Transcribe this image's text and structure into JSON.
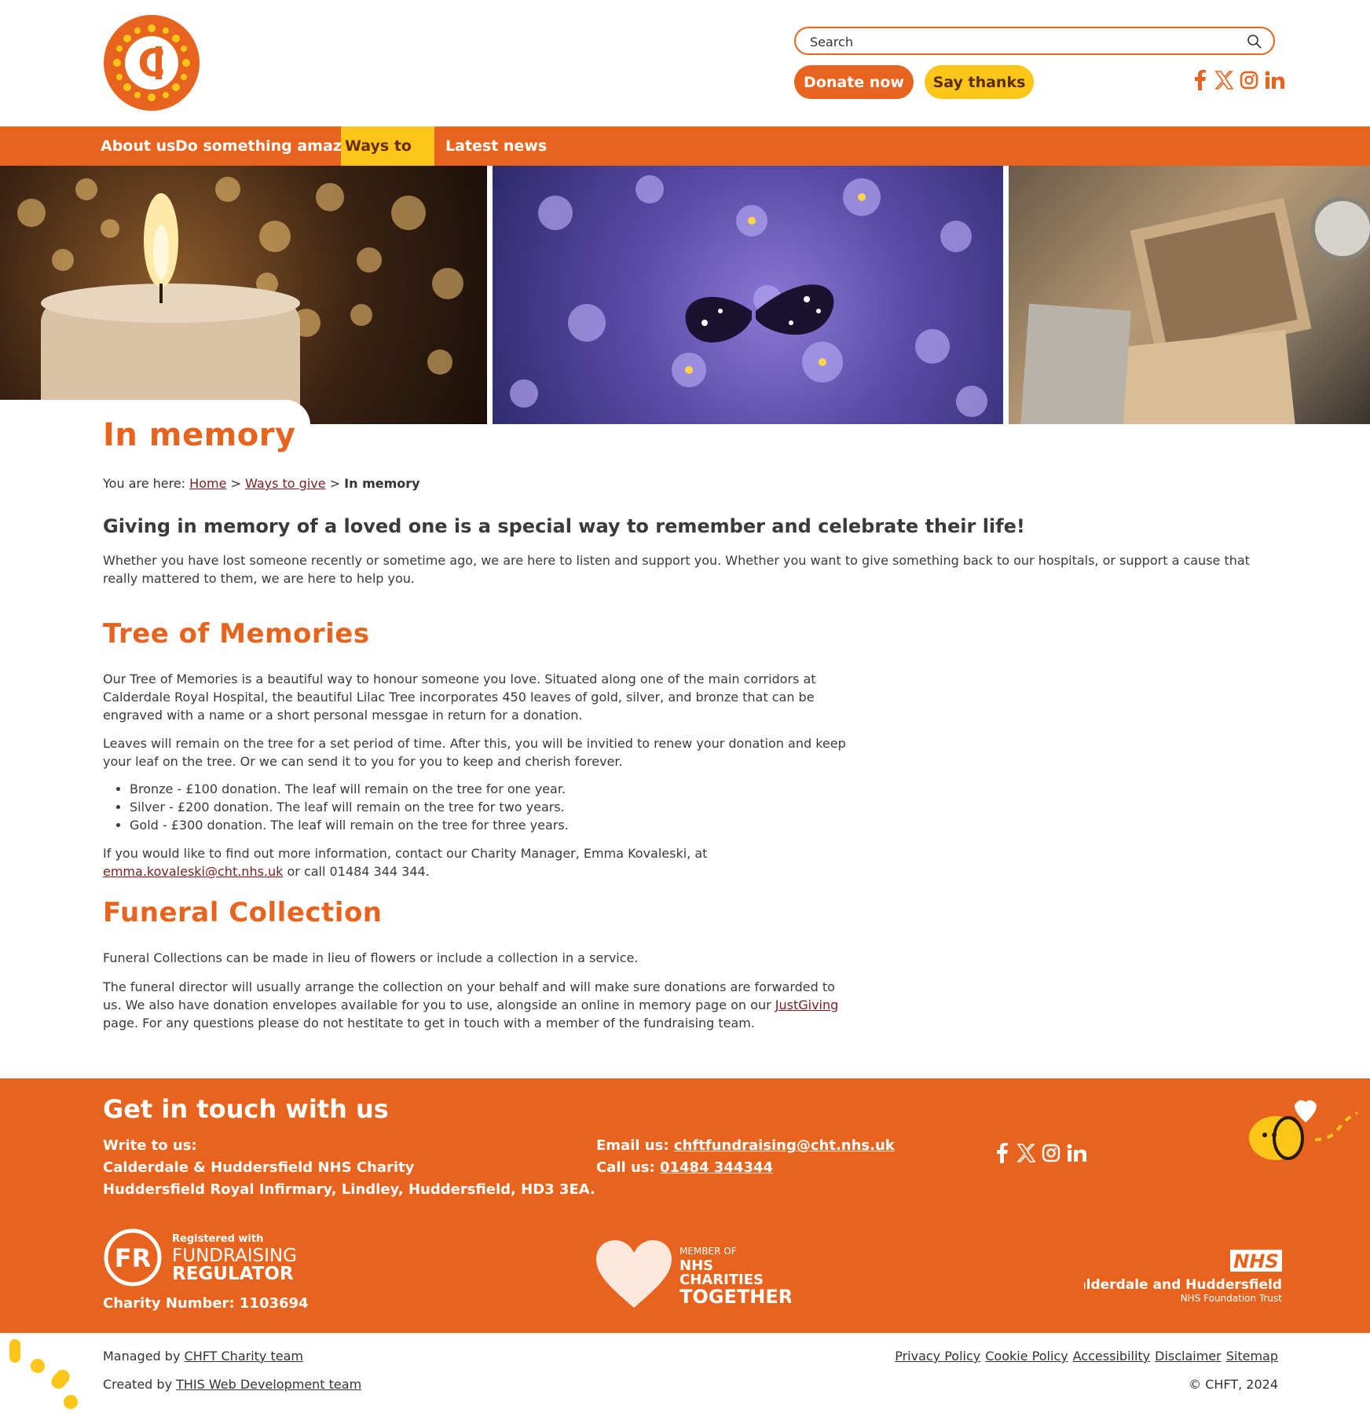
{
  "header": {
    "logo_text": "C",
    "search_placeholder": "Search",
    "donate_label": "Donate now",
    "thanks_label": "Say thanks"
  },
  "nav": [
    {
      "label": "About us"
    },
    {
      "label": "Do something amazing"
    },
    {
      "label": "Ways to give"
    },
    {
      "label": "Latest news"
    }
  ],
  "page": {
    "title": "In memory",
    "breadcrumb": {
      "prefix": "You are here:",
      "home": "Home",
      "sep": ">",
      "section": "Ways to give",
      "current": "In memory"
    },
    "lead": "Giving in memory of a loved one is a special way to remember and celebrate their life!",
    "intro": "Whether you have lost someone recently or sometime ago, we are here to listen and support you. Whether you want to give something back to our hospitals, or support a cause that really mattered to them, we are here to help you."
  },
  "tree": {
    "heading": "Tree of Memories",
    "p1": "Our Tree of Memories is a beautiful way to honour someone you love. Situated along one of the main corridors at Calderdale Royal Hospital, the beautiful Lilac Tree incorporates 450 leaves of gold, silver, and bronze that can be engraved with a name or a short personal messgae in return for a donation.",
    "p2": "Leaves will remain on the tree for a set period of time. After this, you will be invitied to renew your donation and keep your leaf on the tree. Or we can send it to you for you to keep and cherish forever.",
    "items": [
      "Bronze - £100 donation. The leaf will remain on the tree for one year.",
      "Silver - £200 donation. The leaf will remain on the tree for two years.",
      "Gold - £300 donation. The leaf will remain on the tree for three years."
    ],
    "p3_before": "If you would like to find out more information, contact our Charity Manager, Emma Kovaleski, at ",
    "p3_email": "emma.kovaleski@cht.nhs.uk",
    "p3_after": " or call 01484 344 344."
  },
  "funeral": {
    "heading": "Funeral Collection",
    "p1": "Funeral Collections can be made in lieu of flowers or include a collection in a service.",
    "p2_before": "The funeral director will usually arrange the collection on your behalf and will make sure donations are forwarded to us. We also have donation envelopes available for you to use, alongside an online in memory page on our ",
    "p2_link": "JustGiving",
    "p2_after": " page. For any questions please do not hestitate to get in touch with a member of the fundraising team."
  },
  "footer": {
    "title": "Get in touch with us",
    "write_label": "Write to us:",
    "org": "Calderdale & Huddersfield NHS Charity",
    "address": "Huddersfield Royal Infirmary, Lindley, Huddersfield, HD3 3EA.",
    "email_label": "Email us:",
    "email": "chftfundraising@cht.nhs.uk",
    "call_label": "Call us:",
    "phone": "01484 344344",
    "fr_registered": "Registered with",
    "fr_line1": "FUNDRAISING",
    "fr_line2": "REGULATOR",
    "fr_badge": "FR",
    "charity_number": "Charity Number: 1103694",
    "nct_member": "MEMBER OF",
    "nct_line1": "NHS",
    "nct_line2": "CHARITIES",
    "nct_line3": "TOGETHER",
    "nhs_badge": "NHS",
    "trust_name": "Calderdale and Huddersfield",
    "trust_sub": "NHS Foundation Trust"
  },
  "bottom": {
    "managed_prefix": "Managed by",
    "managed_link": "CHFT Charity team",
    "created_prefix": "Created by",
    "created_link": "THIS Web Development team",
    "links": [
      "Privacy Policy",
      "Cookie Policy",
      "Accessibility",
      "Disclaimer",
      "Sitemap"
    ],
    "copyright": "© CHFT, 2024"
  },
  "colors": {
    "brand_orange": "#e8641e",
    "brand_yellow": "#fbc51a",
    "link": "#7a1f1f"
  },
  "icons": [
    "search-icon",
    "facebook-icon",
    "x-icon",
    "instagram-icon",
    "linkedin-icon"
  ]
}
